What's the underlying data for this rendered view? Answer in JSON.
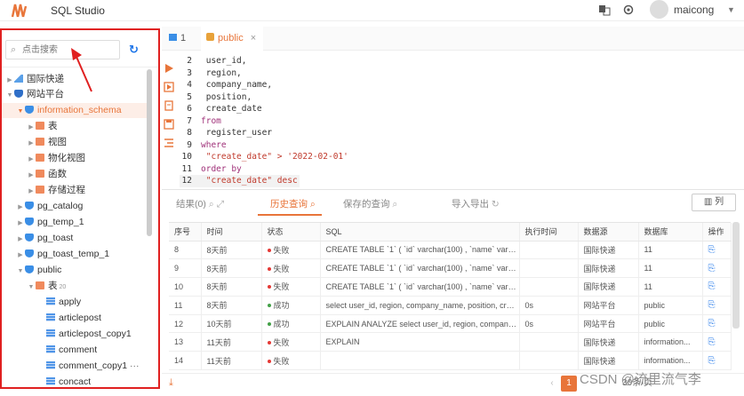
{
  "app": {
    "title": "SQL Studio",
    "user": "maicong",
    "accent": "#e8753a"
  },
  "search": {
    "placeholder": "点击搜索"
  },
  "tree": [
    {
      "label": "国际快递",
      "icon": "chart-icon"
    },
    {
      "label": "网站平台",
      "icon": "link-icon"
    },
    {
      "label": "information_schema",
      "icon": "database-icon"
    },
    {
      "label": "表",
      "icon": "folder-icon"
    },
    {
      "label": "视图",
      "icon": "folder-icon"
    },
    {
      "label": "物化视图",
      "icon": "folder-icon"
    },
    {
      "label": "函数",
      "icon": "folder-icon"
    },
    {
      "label": "存储过程",
      "icon": "folder-icon"
    },
    {
      "label": "pg_catalog",
      "icon": "database-icon"
    },
    {
      "label": "pg_temp_1",
      "icon": "database-icon"
    },
    {
      "label": "pg_toast",
      "icon": "database-icon"
    },
    {
      "label": "pg_toast_temp_1",
      "icon": "database-icon"
    },
    {
      "label": "public",
      "icon": "database-icon"
    },
    {
      "label": "表",
      "icon": "folder-icon",
      "count": "20"
    },
    {
      "label": "apply",
      "icon": "table-icon"
    },
    {
      "label": "articlepost",
      "icon": "table-icon"
    },
    {
      "label": "articlepost_copy1",
      "icon": "table-icon"
    },
    {
      "label": "comment",
      "icon": "table-icon"
    },
    {
      "label": "comment_copy1",
      "icon": "table-icon",
      "more": "···"
    },
    {
      "label": "concact",
      "icon": "table-icon"
    }
  ],
  "editor_tabs": [
    {
      "label": "1"
    },
    {
      "label": "public",
      "close": "×"
    }
  ],
  "code": [
    {
      "n": "2",
      "t": "  user_id,"
    },
    {
      "n": "3",
      "t": "  region,"
    },
    {
      "n": "4",
      "t": "  company_name,"
    },
    {
      "n": "5",
      "t": "  position,"
    },
    {
      "n": "6",
      "t": "  create_date"
    },
    {
      "n": "7",
      "t": "from"
    },
    {
      "n": "8",
      "t": "  register_user"
    },
    {
      "n": "9",
      "t": "where"
    },
    {
      "n": "10",
      "t": "  \"create_date\" > '2022-02-01'"
    },
    {
      "n": "11",
      "t": "order by"
    },
    {
      "n": "12",
      "t": "  \"create_date\" desc"
    }
  ],
  "result_tabs": {
    "results": "结果(0)",
    "history": "历史查询",
    "saved": "保存的查询",
    "io": "导入导出",
    "columns": "列"
  },
  "grid": {
    "headers": [
      "序号",
      "时间",
      "状态",
      "SQL",
      "执行时间",
      "数据源",
      "数据库",
      "操作"
    ],
    "rows": [
      [
        "8",
        "8天前",
        "失败",
        "CREATE TABLE `1` ( `id` varchar(100) , `name` varchar(...",
        "",
        "国际快递",
        "11"
      ],
      [
        "9",
        "8天前",
        "失败",
        "CREATE TABLE `1` ( `id` varchar(100) , `name` varchar(...",
        "",
        "国际快递",
        "11"
      ],
      [
        "10",
        "8天前",
        "失败",
        "CREATE TABLE `1` ( `id` varchar(100) , `name` varchar(...",
        "",
        "国际快递",
        "11"
      ],
      [
        "11",
        "8天前",
        "成功",
        "select user_id, region, company_name, position, crea...",
        "0s",
        "网站平台",
        "public"
      ],
      [
        "12",
        "10天前",
        "成功",
        "EXPLAIN ANALYZE select user_id, region, company_n...",
        "0s",
        "网站平台",
        "public"
      ],
      [
        "13",
        "11天前",
        "失败",
        "EXPLAIN",
        "",
        "国际快递",
        "information..."
      ],
      [
        "14",
        "11天前",
        "失败",
        "",
        "",
        "国际快递",
        "information..."
      ]
    ],
    "fail_color": "#e53935",
    "ok_color": "#43a047"
  },
  "pager": {
    "page": "1",
    "size": "30条/页"
  },
  "watermark": "CSDN @流里流气李"
}
